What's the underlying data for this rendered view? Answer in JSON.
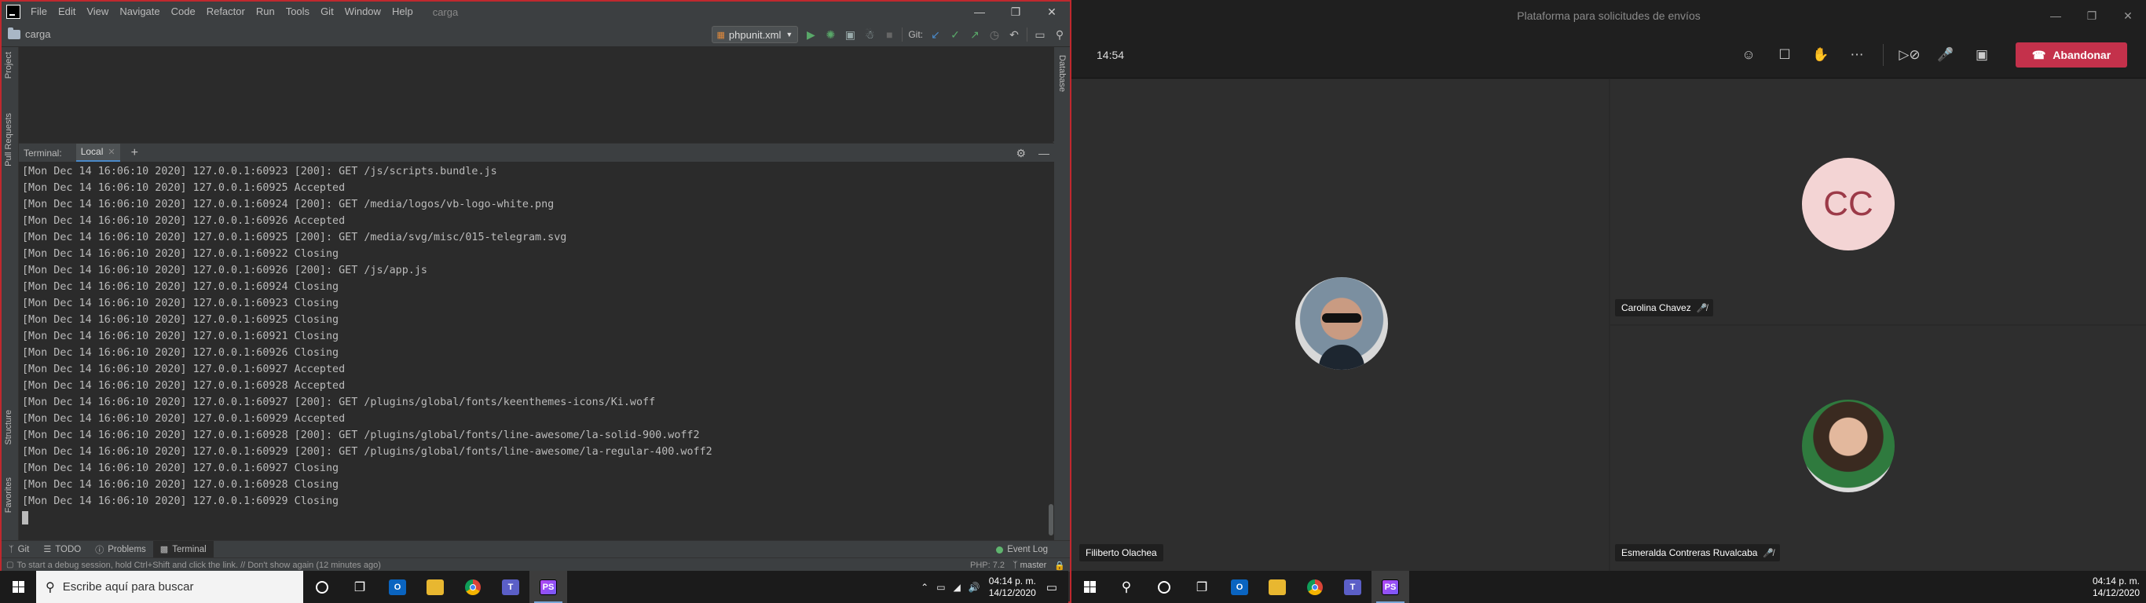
{
  "ide": {
    "menu": [
      "File",
      "Edit",
      "View",
      "Navigate",
      "Code",
      "Refactor",
      "Run",
      "Tools",
      "Git",
      "Window",
      "Help"
    ],
    "project_name": "carga",
    "breadcrumb": "carga",
    "run_config": "phpunit.xml",
    "git_label": "Git:",
    "left_tool_tabs": [
      "Project",
      "Pull Requests",
      "Structure",
      "Favorites"
    ],
    "right_tool_tabs": [
      "Database"
    ],
    "terminal_title": "Terminal:",
    "terminal_tab": "Local",
    "terminal_lines": [
      "[Mon Dec 14 16:06:10 2020] 127.0.0.1:60923 [200]: GET /js/scripts.bundle.js",
      "[Mon Dec 14 16:06:10 2020] 127.0.0.1:60925 Accepted",
      "[Mon Dec 14 16:06:10 2020] 127.0.0.1:60924 [200]: GET /media/logos/vb-logo-white.png",
      "[Mon Dec 14 16:06:10 2020] 127.0.0.1:60926 Accepted",
      "[Mon Dec 14 16:06:10 2020] 127.0.0.1:60925 [200]: GET /media/svg/misc/015-telegram.svg",
      "[Mon Dec 14 16:06:10 2020] 127.0.0.1:60922 Closing",
      "[Mon Dec 14 16:06:10 2020] 127.0.0.1:60926 [200]: GET /js/app.js",
      "[Mon Dec 14 16:06:10 2020] 127.0.0.1:60924 Closing",
      "[Mon Dec 14 16:06:10 2020] 127.0.0.1:60923 Closing",
      "[Mon Dec 14 16:06:10 2020] 127.0.0.1:60925 Closing",
      "[Mon Dec 14 16:06:10 2020] 127.0.0.1:60921 Closing",
      "[Mon Dec 14 16:06:10 2020] 127.0.0.1:60926 Closing",
      "[Mon Dec 14 16:06:10 2020] 127.0.0.1:60927 Accepted",
      "[Mon Dec 14 16:06:10 2020] 127.0.0.1:60928 Accepted",
      "[Mon Dec 14 16:06:10 2020] 127.0.0.1:60927 [200]: GET /plugins/global/fonts/keenthemes-icons/Ki.woff",
      "[Mon Dec 14 16:06:10 2020] 127.0.0.1:60929 Accepted",
      "[Mon Dec 14 16:06:10 2020] 127.0.0.1:60928 [200]: GET /plugins/global/fonts/line-awesome/la-solid-900.woff2",
      "[Mon Dec 14 16:06:10 2020] 127.0.0.1:60929 [200]: GET /plugins/global/fonts/line-awesome/la-regular-400.woff2",
      "[Mon Dec 14 16:06:10 2020] 127.0.0.1:60927 Closing",
      "[Mon Dec 14 16:06:10 2020] 127.0.0.1:60928 Closing",
      "[Mon Dec 14 16:06:10 2020] 127.0.0.1:60929 Closing"
    ],
    "bottom_tabs": {
      "git": "Git",
      "todo": "TODO",
      "problems": "Problems",
      "terminal": "Terminal"
    },
    "event_log": "Event Log",
    "status_message": "To start a debug session, hold Ctrl+Shift and click the link. // Don't show again (12 minutes ago)",
    "php_version": "PHP: 7.2",
    "branch": "master"
  },
  "taskbar": {
    "search_placeholder": "Escribe aquí para buscar",
    "time": "04:14 p. m.",
    "date": "14/12/2020"
  },
  "teams": {
    "window_title": "Plataforma para solicitudes de envíos",
    "meeting_time": "14:54",
    "leave_label": "Abandonar",
    "participants": {
      "carolina": {
        "name": "Carolina Chavez",
        "initials": "CC"
      },
      "filiberto": {
        "name": "Filiberto Olachea"
      },
      "esmeralda": {
        "name": "Esmeralda Contreras Ruvalcaba"
      }
    }
  },
  "colors": {
    "accent_red": "#c4314b",
    "ide_border": "#c0282e",
    "avatar_pink": "#f3d4d4",
    "avatar_text": "#9c3a48"
  }
}
